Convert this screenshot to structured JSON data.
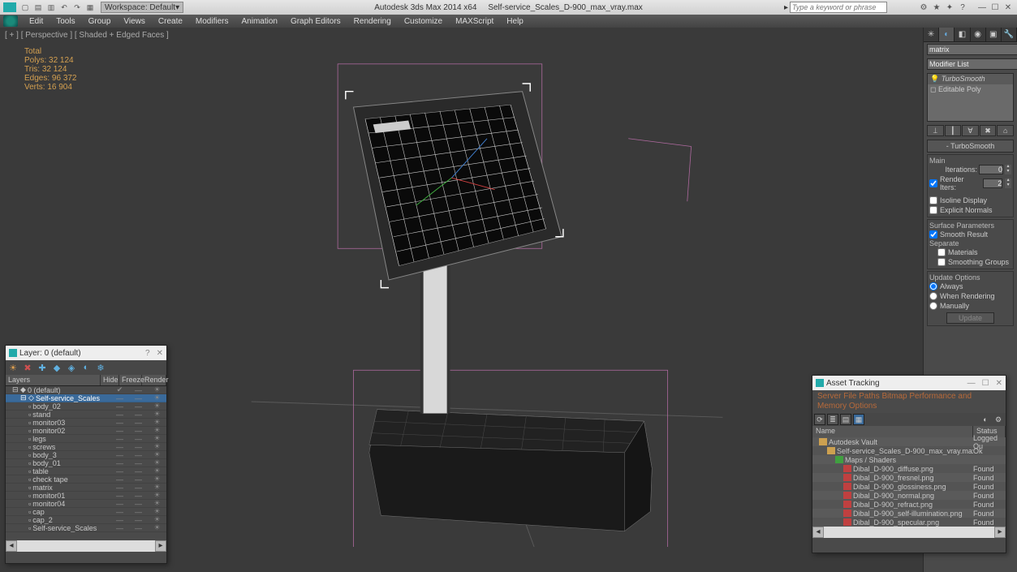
{
  "titlebar": {
    "workspace_label": "Workspace: Default",
    "app_title": "Autodesk 3ds Max 2014 x64",
    "file_name": "Self-service_Scales_D-900_max_vray.max",
    "search_placeholder": "Type a keyword or phrase"
  },
  "menus": [
    "Edit",
    "Tools",
    "Group",
    "Views",
    "Create",
    "Modifiers",
    "Animation",
    "Graph Editors",
    "Rendering",
    "Customize",
    "MAXScript",
    "Help"
  ],
  "viewport": {
    "label": "[ + ] [ Perspective ] [ Shaded + Edged Faces ]",
    "stats": {
      "total": "Total",
      "polys": "Polys:   32 124",
      "tris": "Tris:      32 124",
      "edges": "Edges:  96 372",
      "verts": "Verts:   16 904"
    }
  },
  "cmdpanel": {
    "object_name": "matrix",
    "modlist_label": "Modifier List",
    "stack": [
      "TurboSmooth",
      "Editable Poly"
    ],
    "section": "TurboSmooth",
    "main_label": "Main",
    "iterations_label": "Iterations:",
    "iterations_val": "0",
    "render_iters_label": "Render Iters:",
    "render_iters_val": "2",
    "isoline": "Isoline Display",
    "explicit": "Explicit Normals",
    "surface_label": "Surface Parameters",
    "smooth_result": "Smooth Result",
    "separate_label": "Separate",
    "materials": "Materials",
    "smoothing_groups": "Smoothing Groups",
    "update_label": "Update Options",
    "always": "Always",
    "when_rendering": "When Rendering",
    "manually": "Manually",
    "update_btn": "Update"
  },
  "layer_panel": {
    "title": "Layer: 0 (default)",
    "headers": {
      "layers": "Layers",
      "hide": "Hide",
      "freeze": "Freeze",
      "render": "Render"
    },
    "rows": [
      {
        "indent": 0,
        "name": "0 (default)",
        "sel": false,
        "exp": "⊟"
      },
      {
        "indent": 1,
        "name": "Self-service_Scales",
        "sel": true,
        "exp": "⊟"
      },
      {
        "indent": 2,
        "name": "body_02"
      },
      {
        "indent": 2,
        "name": "stand"
      },
      {
        "indent": 2,
        "name": "monitor03"
      },
      {
        "indent": 2,
        "name": "monitor02"
      },
      {
        "indent": 2,
        "name": "legs"
      },
      {
        "indent": 2,
        "name": "screws"
      },
      {
        "indent": 2,
        "name": "body_3"
      },
      {
        "indent": 2,
        "name": "body_01"
      },
      {
        "indent": 2,
        "name": "table"
      },
      {
        "indent": 2,
        "name": "check tape"
      },
      {
        "indent": 2,
        "name": "matrix"
      },
      {
        "indent": 2,
        "name": "monitor01"
      },
      {
        "indent": 2,
        "name": "monitor04"
      },
      {
        "indent": 2,
        "name": "cap"
      },
      {
        "indent": 2,
        "name": "cap_2"
      },
      {
        "indent": 2,
        "name": "Self-service_Scales"
      }
    ]
  },
  "asset_panel": {
    "title": "Asset Tracking",
    "menus": "Server   File   Paths   Bitmap Performance and Memory Options",
    "name_h": "Name",
    "status_h": "Status",
    "rows": [
      {
        "indent": 0,
        "ico": "folder",
        "name": "Autodesk Vault",
        "status": "Logged Ou"
      },
      {
        "indent": 1,
        "ico": "max",
        "name": "Self-service_Scales_D-900_max_vray.max",
        "status": "Ok"
      },
      {
        "indent": 2,
        "ico": "green",
        "name": "Maps / Shaders",
        "status": ""
      },
      {
        "indent": 3,
        "ico": "red",
        "name": "Dibal_D-900_diffuse.png",
        "status": "Found"
      },
      {
        "indent": 3,
        "ico": "red",
        "name": "Dibal_D-900_fresnel.png",
        "status": "Found"
      },
      {
        "indent": 3,
        "ico": "red",
        "name": "Dibal_D-900_glossiness.png",
        "status": "Found"
      },
      {
        "indent": 3,
        "ico": "red",
        "name": "Dibal_D-900_normal.png",
        "status": "Found"
      },
      {
        "indent": 3,
        "ico": "red",
        "name": "Dibal_D-900_refract.png",
        "status": "Found"
      },
      {
        "indent": 3,
        "ico": "red",
        "name": "Dibal_D-900_self-illumination.png",
        "status": "Found"
      },
      {
        "indent": 3,
        "ico": "red",
        "name": "Dibal_D-900_specular.png",
        "status": "Found"
      }
    ]
  }
}
